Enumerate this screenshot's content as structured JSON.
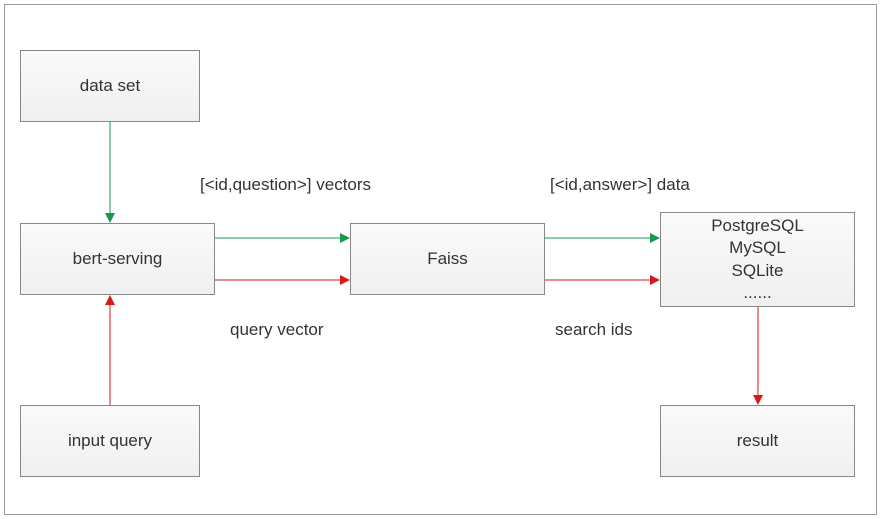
{
  "boxes": {
    "data_set": "data set",
    "bert_serving": "bert-serving",
    "input_query": "input query",
    "faiss": "Faiss",
    "databases_line1": "PostgreSQL",
    "databases_line2": "MySQL",
    "databases_line3": "SQLite",
    "databases_line4": "......",
    "result": "result"
  },
  "labels": {
    "vectors": "[<id,question>] vectors",
    "data": "[<id,answer>] data",
    "query_vector": "query vector",
    "search_ids": "search ids"
  },
  "arrows": {
    "dataset_to_bert": {
      "from": "data_set",
      "to": "bert_serving",
      "color": "green"
    },
    "bert_to_faiss_green": {
      "from": "bert_serving",
      "to": "faiss",
      "color": "green",
      "label": "vectors"
    },
    "faiss_to_db_green": {
      "from": "faiss",
      "to": "databases",
      "color": "green",
      "label": "data"
    },
    "inputquery_to_bert": {
      "from": "input_query",
      "to": "bert_serving",
      "color": "red"
    },
    "bert_to_faiss_red": {
      "from": "bert_serving",
      "to": "faiss",
      "color": "red",
      "label": "query_vector"
    },
    "faiss_to_db_red": {
      "from": "faiss",
      "to": "databases",
      "color": "red",
      "label": "search_ids"
    },
    "db_to_result": {
      "from": "databases",
      "to": "result",
      "color": "red"
    }
  }
}
